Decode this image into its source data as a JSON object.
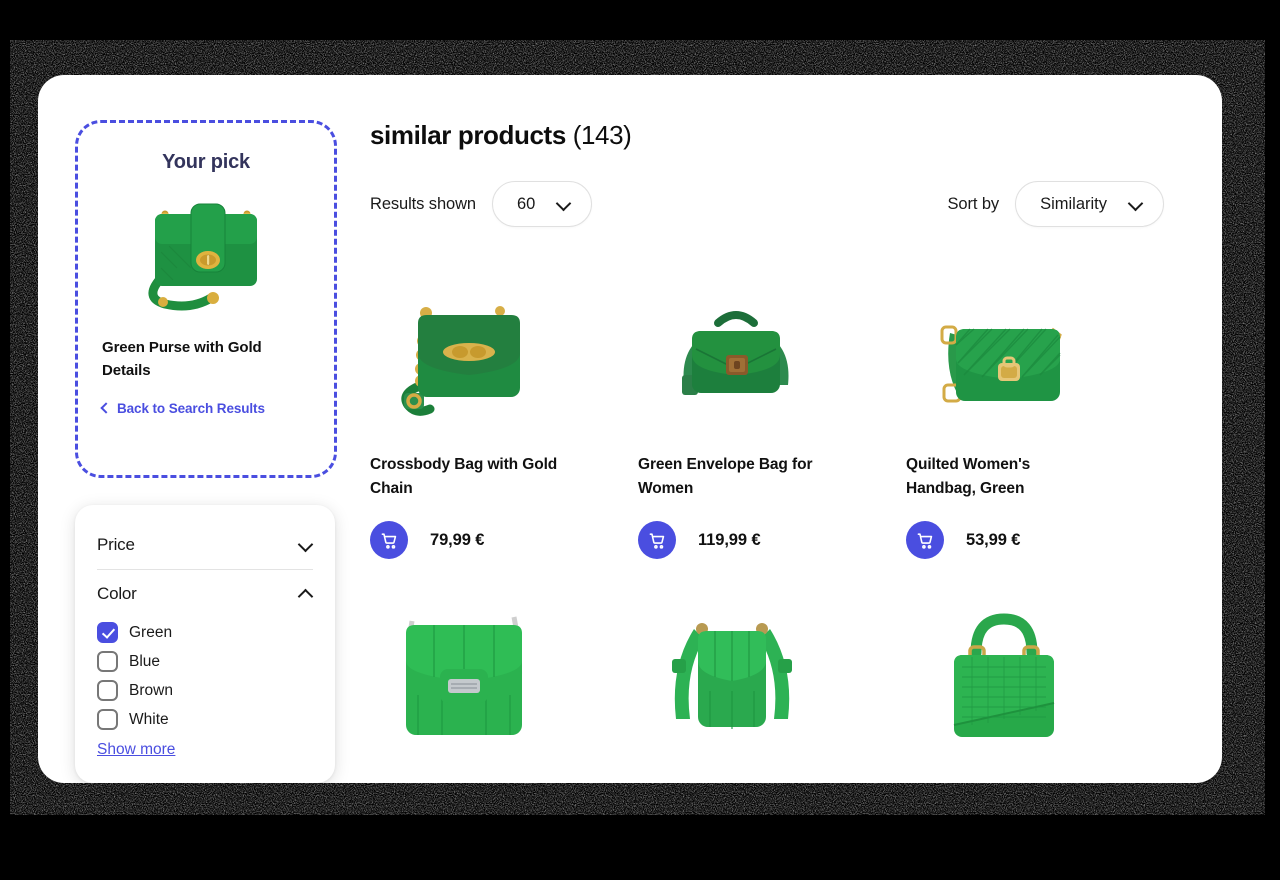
{
  "your_pick": {
    "heading": "Your pick",
    "product_title": "Green Purse with Gold Details",
    "back_link": "Back to Search Results",
    "back_icon": "chevron-left-icon",
    "image_alt": "green-purse-with-gold-chain"
  },
  "filters": {
    "price": {
      "label": "Price",
      "expanded": false,
      "chevron": "chevron-down-icon"
    },
    "color": {
      "label": "Color",
      "expanded": true,
      "chevron": "chevron-up-icon",
      "options": [
        {
          "label": "Green",
          "checked": true
        },
        {
          "label": "Blue",
          "checked": false
        },
        {
          "label": "Brown",
          "checked": false
        },
        {
          "label": "White",
          "checked": false
        }
      ],
      "show_more": "Show more"
    }
  },
  "header": {
    "title_strong": "similar products",
    "title_count": "(143)"
  },
  "controls": {
    "results_shown": {
      "label": "Results shown",
      "value": "60",
      "chevron": "chevron-down-icon"
    },
    "sort_by": {
      "label": "Sort by",
      "value": "Similarity",
      "chevron": "chevron-down-icon"
    }
  },
  "products": [
    {
      "title": "Crossbody Bag with Gold Chain",
      "price": "79,99 €",
      "cart_icon": "shopping-cart-icon",
      "image_alt": "green-crossbody-bag-gold-chain"
    },
    {
      "title": "Green Envelope Bag for Women",
      "price": "119,99 €",
      "cart_icon": "shopping-cart-icon",
      "image_alt": "green-envelope-bag"
    },
    {
      "title": "Quilted Women's Handbag, Green",
      "price": "53,99 €",
      "cart_icon": "shopping-cart-icon",
      "image_alt": "green-quilted-handbag"
    }
  ],
  "products_row2": [
    {
      "image_alt": "green-padded-shoulder-bag-silver-clasp"
    },
    {
      "image_alt": "green-quilted-crossbody-bag"
    },
    {
      "image_alt": "green-croc-top-handle-bag"
    }
  ],
  "colors": {
    "accent": "#4a4ee0",
    "navy": "#33345c",
    "page_bg": "#000000",
    "card_bg": "#ffffff",
    "bag_green": "#24a144"
  }
}
